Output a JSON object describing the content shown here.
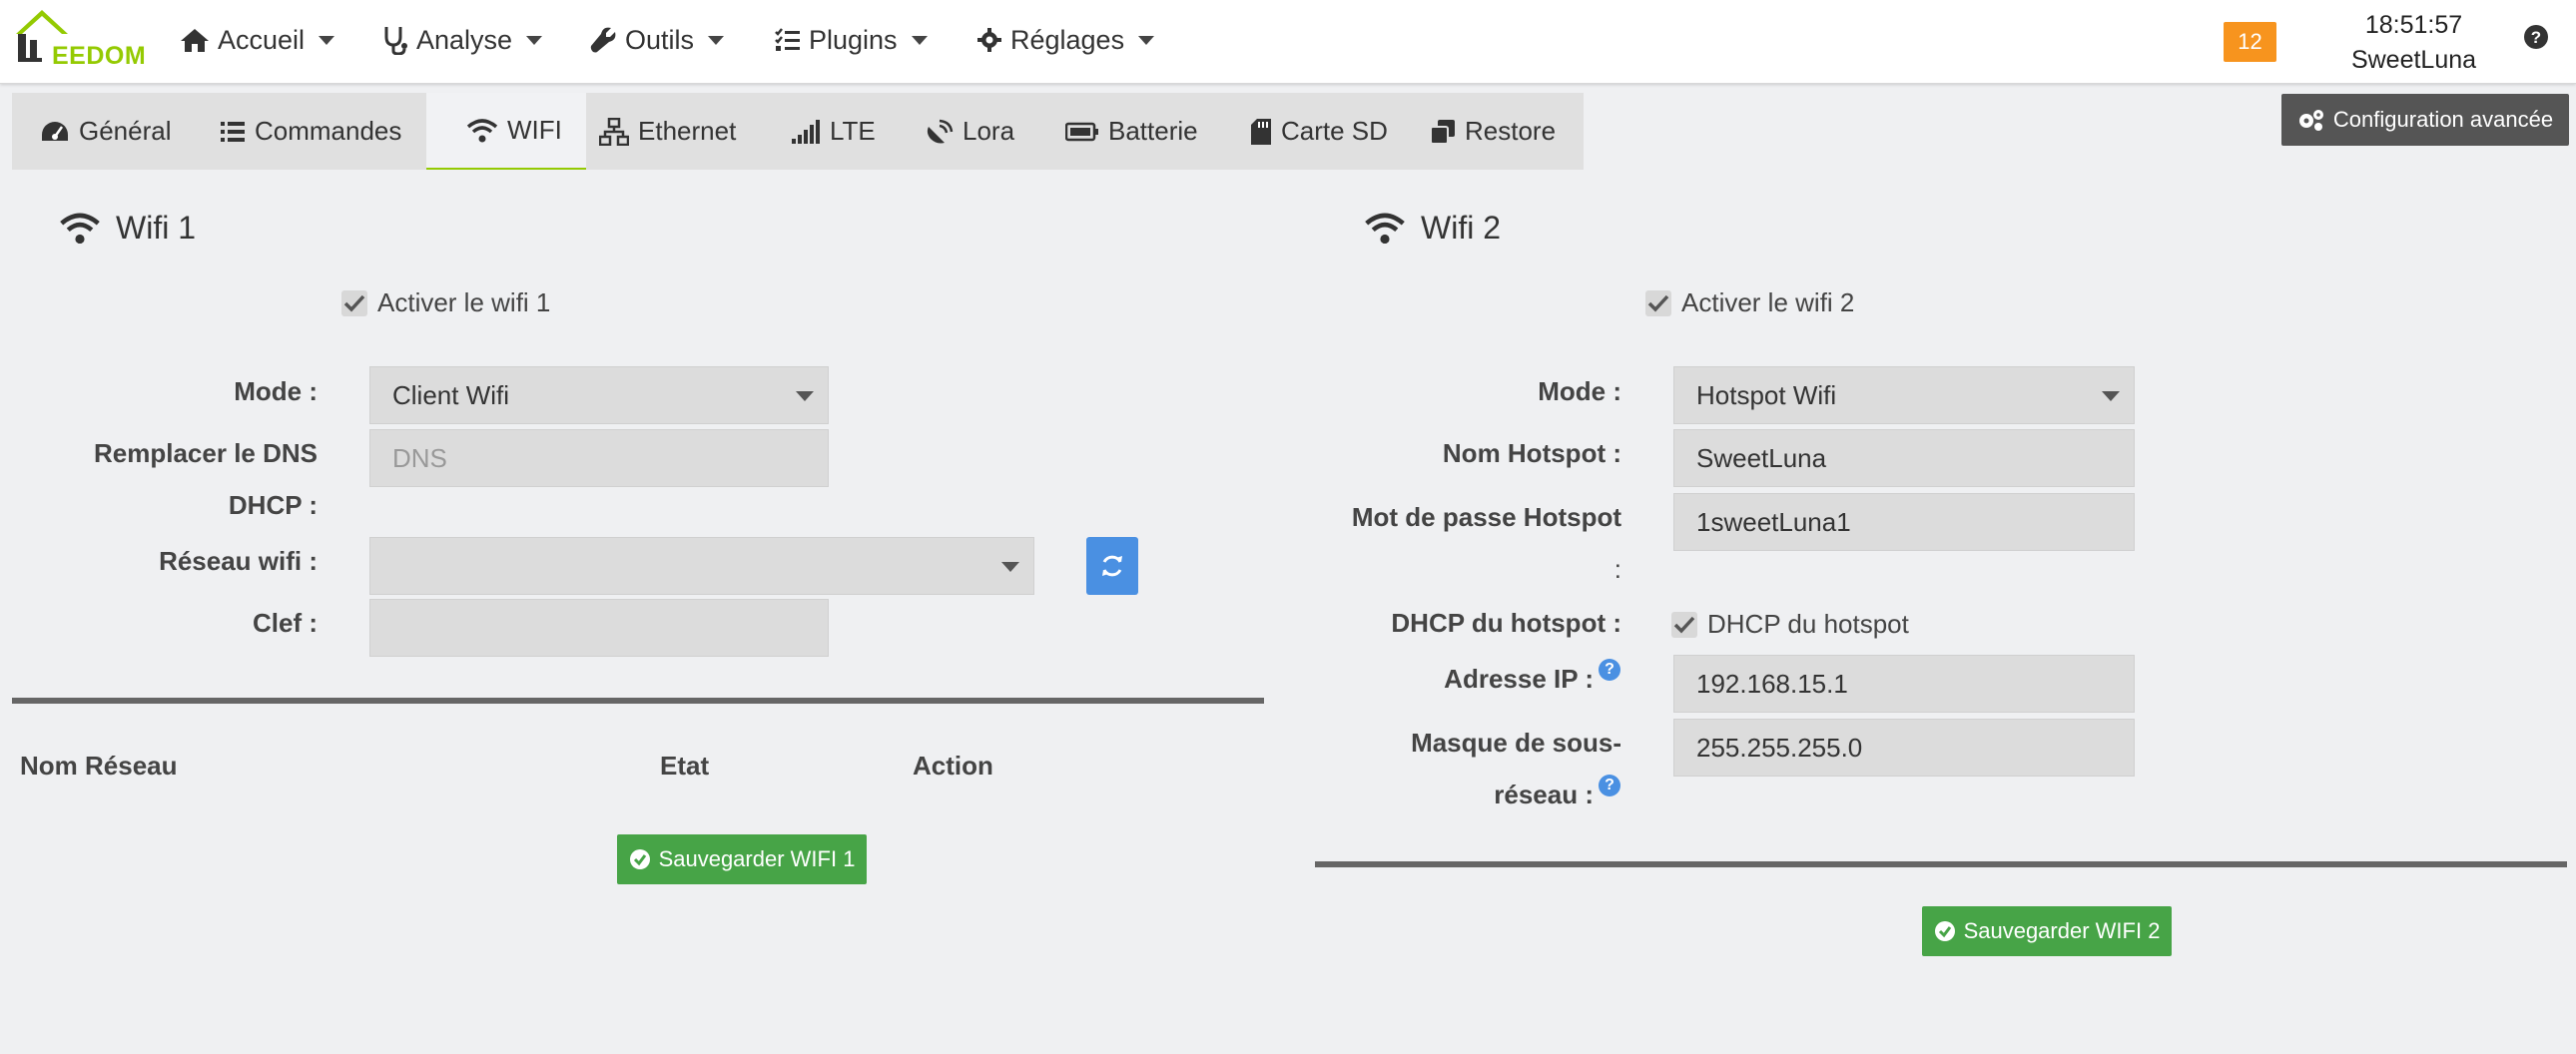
{
  "brand": {
    "logo_text": "EEDOM"
  },
  "nav": {
    "accueil": "Accueil",
    "analyse": "Analyse",
    "outils": "Outils",
    "plugins": "Plugins",
    "reglages": "Réglages"
  },
  "status": {
    "notifications": "12",
    "time": "18:51:57",
    "user": "SweetLuna"
  },
  "tabs": {
    "general": "Général",
    "commandes": "Commandes",
    "wifi": "WIFI",
    "ethernet": "Ethernet",
    "lte": "LTE",
    "lora": "Lora",
    "batterie": "Batterie",
    "carte_sd": "Carte SD",
    "restore": "Restore"
  },
  "advanced_button": "Configuration avancée",
  "wifi1": {
    "title": "Wifi 1",
    "enable_label": "Activer le wifi 1",
    "mode_label": "Mode :",
    "mode_value": "Client Wifi",
    "dns_label_line1": "Remplacer le DNS",
    "dns_label_line2": "DHCP :",
    "dns_placeholder": "DNS",
    "network_label": "Réseau wifi :",
    "network_value": "",
    "key_label": "Clef :",
    "key_value": "",
    "table_headers": {
      "name": "Nom Réseau",
      "state": "Etat",
      "action": "Action"
    },
    "save_label": "Sauvegarder WIFI 1"
  },
  "wifi2": {
    "title": "Wifi 2",
    "enable_label": "Activer le wifi 2",
    "mode_label": "Mode :",
    "mode_value": "Hotspot Wifi",
    "hotspot_name_label": "Nom Hotspot :",
    "hotspot_name_value": "SweetLuna",
    "password_label_line1": "Mot de passe Hotspot",
    "password_label_line2": ":",
    "password_value": "1sweetLuna1",
    "dhcp_label": "DHCP du hotspot :",
    "dhcp_check_label": "DHCP du hotspot",
    "ip_label": "Adresse IP :",
    "ip_value": "192.168.15.1",
    "mask_label_line1": "Masque de sous-",
    "mask_label_line2": "réseau :",
    "mask_value": "255.255.255.0",
    "help_mark": "?",
    "save_label": "Sauvegarder WIFI 2"
  },
  "colors": {
    "accent": "#94ca02",
    "save": "#47a447",
    "info": "#4a90e2",
    "badge": "#f7941e"
  }
}
